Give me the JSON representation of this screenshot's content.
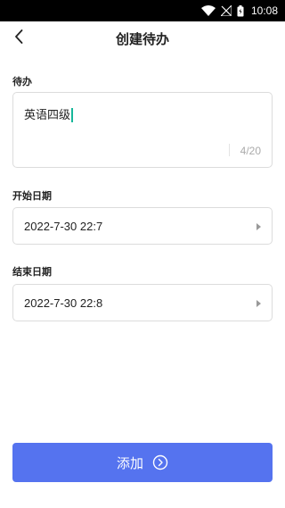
{
  "status_bar": {
    "time": "10:08",
    "icons": [
      "wifi-icon",
      "signal-icon",
      "battery-icon"
    ]
  },
  "header": {
    "title": "创建待办",
    "back_icon": "chevron-left-icon"
  },
  "todo": {
    "label": "待办",
    "value": "英语四级",
    "counter": "4/20"
  },
  "start_date": {
    "label": "开始日期",
    "value": "2022-7-30 22:7"
  },
  "end_date": {
    "label": "结束日期",
    "value": "2022-7-30 22:8"
  },
  "add_button": {
    "label": "添加",
    "icon": "arrow-circle-right-icon"
  },
  "colors": {
    "accent": "#5573ef",
    "caret": "#17b79a",
    "border": "#dcdcdc"
  }
}
